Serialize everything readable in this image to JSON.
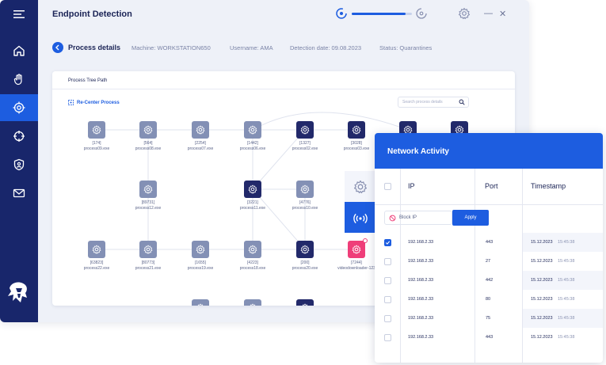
{
  "app": {
    "title": "Endpoint Detection",
    "scan_progress": 0.9
  },
  "info": {
    "page_title": "Process details",
    "machine": "Machine: WORKSTATION650",
    "username": "Username: AMA",
    "detection_date": "Detection date: 09.08.2023",
    "status": "Status: Quarantines"
  },
  "card": {
    "title": "Process Tree Path",
    "recenter": "Re-Center Process",
    "search_placeholder": "Search process details"
  },
  "nodes": [
    {
      "id": "[174]",
      "name": "process09.exe"
    },
    {
      "id": "[564]",
      "name": "process08.exe"
    },
    {
      "id": "[2254]",
      "name": "process07.exe"
    },
    {
      "id": "[1442]",
      "name": "process06.exe"
    },
    {
      "id": "[1327]",
      "name": "process02.exe"
    },
    {
      "id": "[3028]",
      "name": "process03.exe"
    },
    {
      "id": "[89731]",
      "name": "process12.exe"
    },
    {
      "id": "[3221]",
      "name": "process11.exe"
    },
    {
      "id": "[4776]",
      "name": "process10.exe"
    },
    {
      "id": "[63823]",
      "name": "process22.exe"
    },
    {
      "id": "[80773]",
      "name": "process21.exe"
    },
    {
      "id": "[1655]",
      "name": "process19.exe"
    },
    {
      "id": "[4223]",
      "name": "process18.exe"
    },
    {
      "id": "[200]",
      "name": "process20.exe"
    },
    {
      "id": "[7244]",
      "name": "videodownloader-123"
    }
  ],
  "network": {
    "title": "Network Activity",
    "col_ip": "IP",
    "col_port": "Port",
    "col_timestamp": "Timestamp",
    "block_placeholder": "Block IP",
    "apply_label": "Apply",
    "rows": [
      {
        "ip": "192.168.2.33",
        "port": "443",
        "date": "15.12.2023",
        "time": "15:45:38",
        "checked": true
      },
      {
        "ip": "192.168.2.33",
        "port": "27",
        "date": "15.12.2023",
        "time": "15:45:38",
        "checked": false
      },
      {
        "ip": "192.168.2.33",
        "port": "442",
        "date": "15.12.2023",
        "time": "15:45:38",
        "checked": false
      },
      {
        "ip": "192.168.2.33",
        "port": "80",
        "date": "15.12.2023",
        "time": "15:45:38",
        "checked": false
      },
      {
        "ip": "192.168.2.33",
        "port": "75",
        "date": "15.12.2023",
        "time": "15:45:38",
        "checked": false
      },
      {
        "ip": "192.168.2.33",
        "port": "443",
        "date": "15.12.2023",
        "time": "15:45:38",
        "checked": false
      }
    ]
  },
  "icons": {
    "sidebar": [
      "home-icon",
      "hand-icon",
      "target-icon",
      "crosshair-icon",
      "shield-user-icon",
      "mail-icon"
    ],
    "logo": "warrior-logo-icon"
  },
  "colors": {
    "accent": "#1d5de0",
    "sidebar": "#18266b",
    "node_gray": "#8390b5",
    "node_dark": "#22296a",
    "node_alert": "#ef3e79"
  }
}
